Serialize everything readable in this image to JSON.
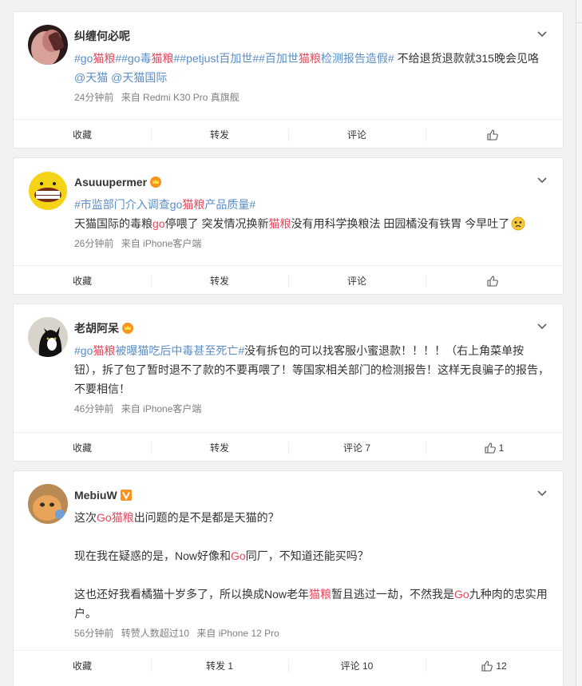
{
  "colors": {
    "topic": "#5b8ec7",
    "keyword": "#e8475b",
    "muted": "#808080"
  },
  "posts": [
    {
      "name": "纠缠何必呢",
      "badge": "",
      "text_parts": [
        {
          "t": "#go",
          "c": "tag"
        },
        {
          "t": "猫粮",
          "c": "red"
        },
        {
          "t": "##go",
          "c": "tag"
        },
        {
          "t": "毒",
          "c": "tag"
        },
        {
          "t": "猫粮",
          "c": "red"
        },
        {
          "t": "##petjust百加世##百加世",
          "c": "tag"
        },
        {
          "t": "猫粮",
          "c": "red"
        },
        {
          "t": "检测报告造假#",
          "c": "tag"
        },
        {
          "t": " 不给退货退款就315晚会见咯",
          "c": ""
        },
        {
          "t": "@天猫 @天猫国际",
          "c": "tag"
        }
      ],
      "time": "24分钟前",
      "source": "来自 Redmi K30 Pro 真旗舰",
      "actions": {
        "fav": "收藏",
        "repost": "转发",
        "comment": "评论",
        "like": ""
      }
    },
    {
      "name": "Asuuupermer",
      "badge": "crown",
      "text_parts": [
        {
          "t": "#市监部门介入调查go",
          "c": "tag"
        },
        {
          "t": "猫粮",
          "c": "red"
        },
        {
          "t": "产品质量#",
          "c": "tag"
        }
      ],
      "text2_parts": [
        {
          "t": "天猫国际的毒粮",
          "c": ""
        },
        {
          "t": "go",
          "c": "red"
        },
        {
          "t": "停喂了 突发情况换新",
          "c": ""
        },
        {
          "t": "猫粮",
          "c": "red"
        },
        {
          "t": "没有用科学换粮法 田园橘没有铁胃 今早吐了",
          "c": ""
        }
      ],
      "time": "26分钟前",
      "source": "来自 iPhone客户端",
      "actions": {
        "fav": "收藏",
        "repost": "转发",
        "comment": "评论",
        "like": ""
      }
    },
    {
      "name": "老胡阿呆",
      "badge": "crown",
      "text_parts": [
        {
          "t": "#go",
          "c": "tag"
        },
        {
          "t": "猫粮",
          "c": "red"
        },
        {
          "t": "被曝猫吃后中毒甚至死亡#",
          "c": "tag"
        },
        {
          "t": "没有拆包的可以找客服小蜜退款！！！！（右上角菜单按钮），拆了包了暂时退不了款的不要再喂了！等国家相关部门的检测报告！这样无良骗子的报告，不要相信！",
          "c": ""
        }
      ],
      "time": "46分钟前",
      "source": "来自 iPhone客户端",
      "actions": {
        "fav": "收藏",
        "repost": "转发",
        "comment": "评论 7",
        "like": "1"
      }
    },
    {
      "name": "MebiuW",
      "badge": "v",
      "para1_parts": [
        {
          "t": "这次",
          "c": ""
        },
        {
          "t": "Go",
          "c": "red"
        },
        {
          "t": "猫粮",
          "c": "red"
        },
        {
          "t": "出问题的是不是都是天猫的？",
          "c": ""
        }
      ],
      "para2_parts": [
        {
          "t": "现在我在疑惑的是，Now好像和",
          "c": ""
        },
        {
          "t": "Go",
          "c": "red"
        },
        {
          "t": "同厂，不知道还能买吗？",
          "c": ""
        }
      ],
      "para3_parts": [
        {
          "t": "这也还好我看橘猫十岁多了，所以换成Now老年",
          "c": ""
        },
        {
          "t": "猫粮",
          "c": "red"
        },
        {
          "t": "暂且逃过一劫，不然我是",
          "c": ""
        },
        {
          "t": "Go",
          "c": "red"
        },
        {
          "t": "九种肉的忠实用户。",
          "c": ""
        }
      ],
      "time": "56分钟前",
      "extra": "转赞人数超过10",
      "source": "来自 iPhone 12 Pro",
      "actions": {
        "fav": "收藏",
        "repost": "转发 1",
        "comment": "评论 10",
        "like": "12"
      }
    }
  ]
}
